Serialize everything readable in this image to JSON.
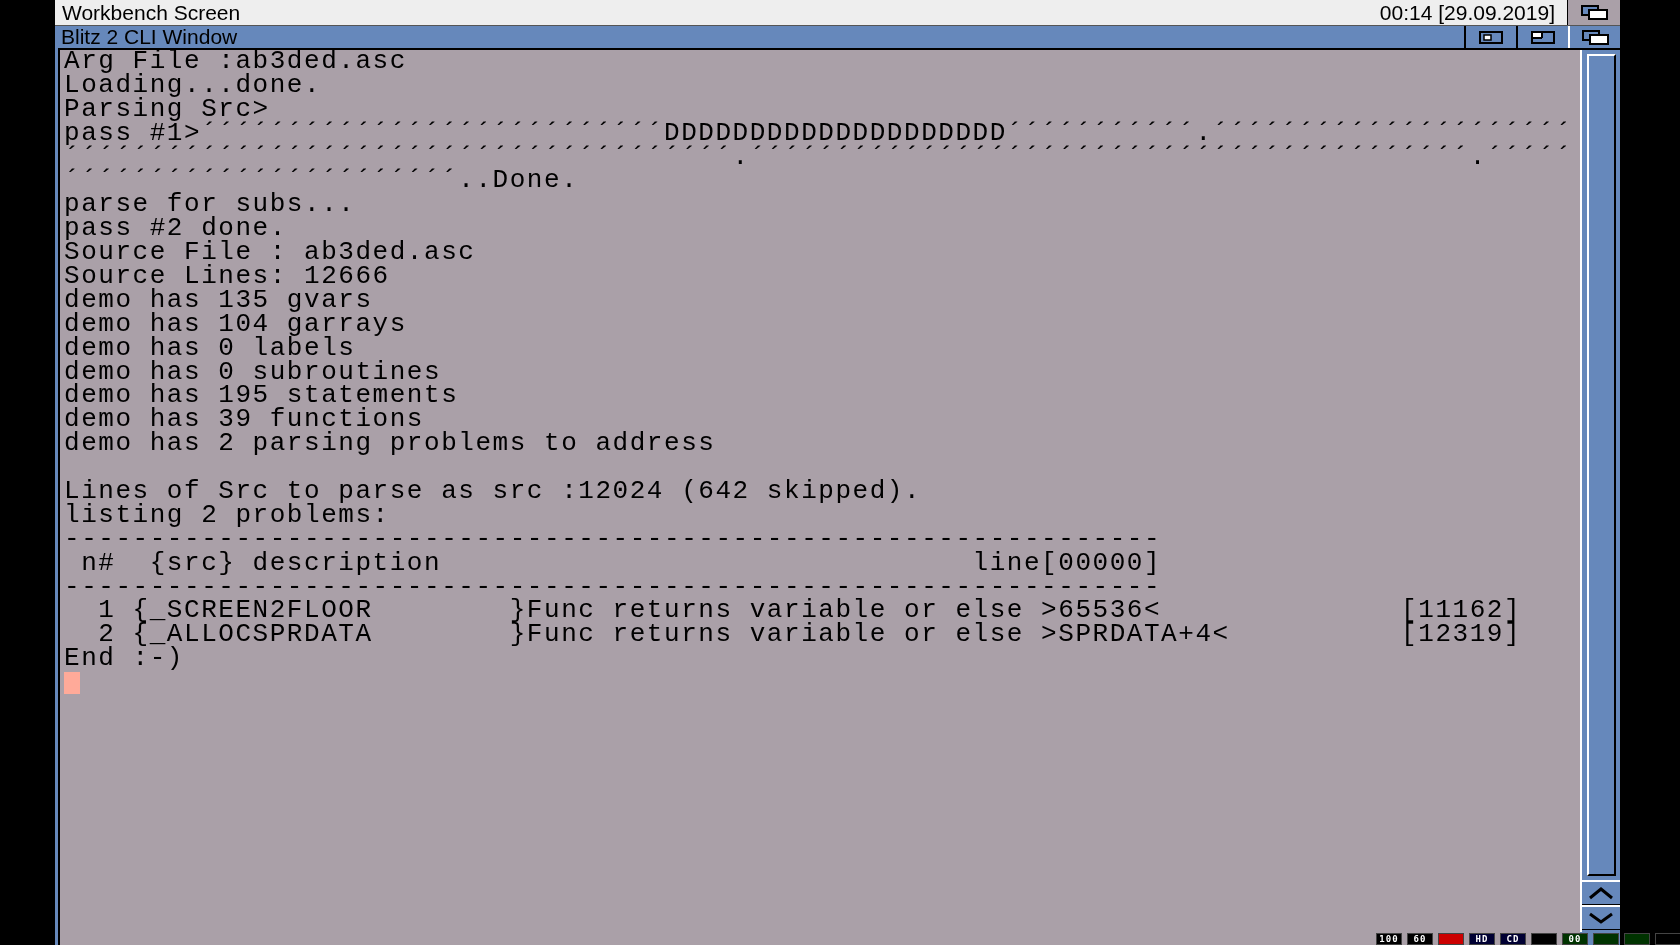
{
  "screen": {
    "title": "Workbench Screen",
    "clock": "00:14 [29.09.2019]"
  },
  "window": {
    "title": "Blitz 2 CLI Window"
  },
  "console": {
    "blocks": [
      [
        "Arg File :ab3ded.asc",
        "Loading...done.",
        "Parsing Src>",
        "pass #1>´´´´´´´´´´´´´´´´´´´´´´´´´´´DDDDDDDDDDDDDDDDDDDD´´´´´´´´´´´.´´´´´´´´´´´´´´´´´´´´´",
        "´´´´´´´´´´´´´´´´´´´´´´´´´´´´´´´´´´´´´´´.´´´´´´´´´´´´´´´´´´´´´´´´´´´´´´´´´´´´´´´´´´.´´´´´",
        "´´´´´´´´´´´´´´´´´´´´´´´..Done.",
        "parse for subs...",
        "pass #2 done.",
        "Source File : ab3ded.asc",
        "Source Lines: 12666",
        "demo has 135 gvars",
        "demo has 104 garrays",
        "demo has 0 labels",
        "demo has 0 subroutines",
        "demo has 195 statements",
        "demo has 39 functions",
        "demo has 2 parsing problems to address"
      ],
      [
        "Lines of Src to parse as src :12024 (642 skipped).",
        "listing 2 problems:",
        "----------------------------------------------------------------",
        " n#  {src} description                               line[00000]",
        "----------------------------------------------------------------",
        "  1 {_SCREEN2FLOOR        }Func returns variable or else >65536<              [11162]",
        "  2 {_ALLOCSPRDATA        }Func returns variable or else >SPRDATA+4<          [12319]",
        "End :-)"
      ]
    ]
  },
  "status_lights": [
    {
      "label": "100",
      "color": "#000000"
    },
    {
      "label": "60",
      "color": "#000000"
    },
    {
      "color": "#cc0000"
    },
    {
      "label": "HD",
      "color": "#000033"
    },
    {
      "label": "CD",
      "color": "#000033"
    },
    {
      "color": "#000000"
    },
    {
      "label": "00",
      "color": "#003300"
    },
    {
      "color": "#003300"
    },
    {
      "color": "#003300"
    },
    {
      "color": "#000000"
    }
  ]
}
